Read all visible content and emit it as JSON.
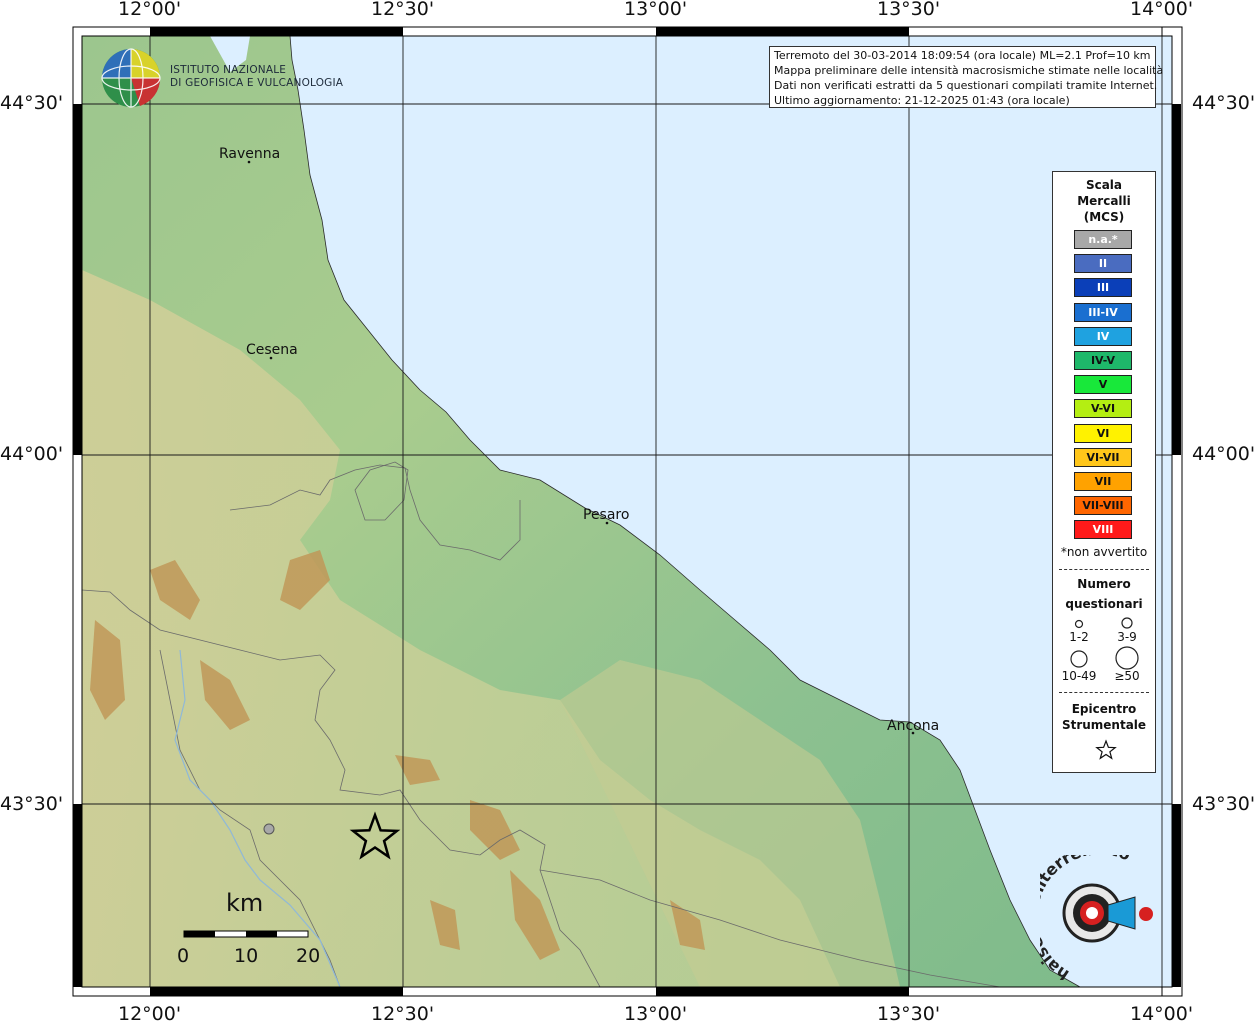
{
  "map": {
    "info_lines": [
      "Terremoto del 30-03-2014 18:09:54 (ora locale) ML=2.1 Prof=10 km",
      "Mappa preliminare delle intensità macrosismiche stimate nelle località",
      "Dati non verificati estratti da 5 questionari compilati tramite Internet.",
      "Ultimo aggiornamento: 21-12-2025 01:43 (ora locale)"
    ],
    "institute": [
      "ISTITUTO NAZIONALE",
      "DI GEOFISICA E VULCANOLOGIA"
    ],
    "longitude_labels": [
      "12°00'",
      "12°30'",
      "13°00'",
      "13°30'",
      "14°00'"
    ],
    "latitude_labels": [
      "44°30'",
      "44°00'",
      "43°30'"
    ],
    "cities": [
      "Ravenna",
      "Cesena",
      "Pesaro",
      "Ancona"
    ],
    "legend": {
      "scale_title": [
        "Scala",
        "Mercalli",
        "(MCS)"
      ],
      "levels": [
        {
          "label": "n.a.*",
          "color": "#a8a8a8"
        },
        {
          "label": "II",
          "color": "#4a6cc0"
        },
        {
          "label": "III",
          "color": "#0b3fb8"
        },
        {
          "label": "III-IV",
          "color": "#1a6fd0"
        },
        {
          "label": "IV",
          "color": "#1fa2e0"
        },
        {
          "label": "IV-V",
          "color": "#1eb86a"
        },
        {
          "label": "V",
          "color": "#18e83a"
        },
        {
          "label": "V-VI",
          "color": "#b4ee12"
        },
        {
          "label": "VI",
          "color": "#fff200"
        },
        {
          "label": "VI-VII",
          "color": "#ffc61a"
        },
        {
          "label": "VII",
          "color": "#ffa200"
        },
        {
          "label": "VII-VIII",
          "color": "#ff6600"
        },
        {
          "label": "VIII",
          "color": "#ff1a1a"
        }
      ],
      "not_felt_note": "*non avvertito",
      "questionnaire_title": [
        "Numero",
        "questionari"
      ],
      "questionnaire_sizes": [
        "1-2",
        "3-9",
        "10-49",
        "≥50"
      ],
      "epicenter_title": [
        "Epicentro",
        "Strumentale"
      ]
    },
    "scale_bar": {
      "unit": "km",
      "ticks": [
        "0",
        "10",
        "20"
      ]
    },
    "website_logo": "haisentitoilterremoto.it",
    "colors": {
      "sea": "#dcefff",
      "lowland": "#8fc08c",
      "hills": "#c9c98e",
      "mountains": "#c39a5a",
      "frame": "#000000"
    }
  }
}
